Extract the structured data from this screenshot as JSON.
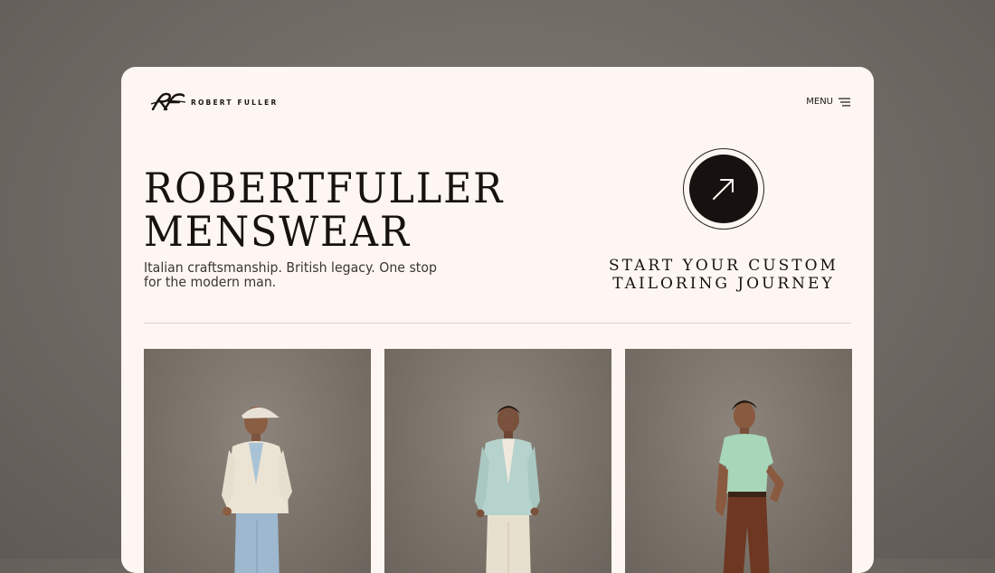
{
  "brand": {
    "monogram": "RF",
    "wordmark": "ROBERT FULLER"
  },
  "nav": {
    "menu_label": "MENU"
  },
  "hero": {
    "title_line1": "ROBERTFULLER",
    "title_line2": "MENSWEAR",
    "subtitle": "Italian craftsmanship. British legacy. One stop for the modern man."
  },
  "cta": {
    "line1": "START YOUR CUSTOM",
    "line2": "TAILORING JOURNEY",
    "icon": "arrow-up-right-icon"
  },
  "gallery": {
    "items": [
      {
        "name": "model-cream-blazer-cap"
      },
      {
        "name": "model-mint-cardigan"
      },
      {
        "name": "model-green-polo-brown-trousers"
      }
    ]
  },
  "colors": {
    "card_background": "#fdf6f2",
    "text_dark": "#17120f",
    "cta_circle": "#171210",
    "page_background": "#75706b"
  }
}
